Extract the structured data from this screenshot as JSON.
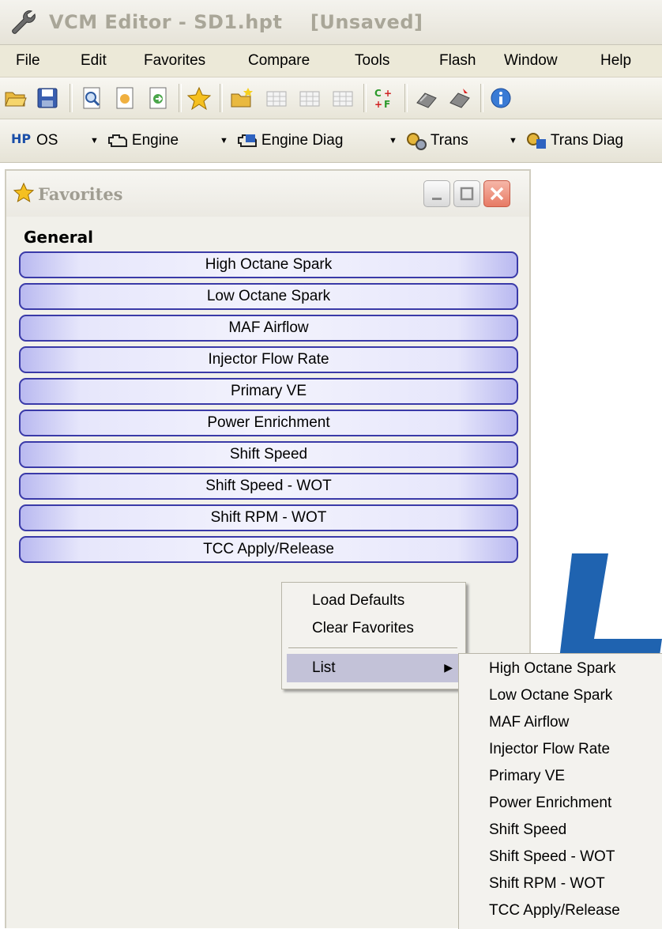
{
  "window": {
    "title": "VCM Editor - SD1.hpt    [Unsaved]"
  },
  "menu": [
    "File",
    "Edit",
    "Favorites",
    "Compare",
    "Tools",
    "Flash",
    "Window",
    "Help"
  ],
  "toolbar": {
    "icons": [
      "open-folder-icon",
      "save-icon",
      "document-search-icon",
      "document-icon",
      "document-go-icon",
      "favorites-star-icon",
      "new-folder-icon",
      "table-icon",
      "table-edit-icon",
      "table-compare-icon",
      "compare-cf-icon",
      "read-vehicle-icon",
      "write-vehicle-icon",
      "info-icon"
    ]
  },
  "modules": [
    {
      "label": "OS",
      "icon": "hp-logo-icon"
    },
    {
      "label": "Engine",
      "icon": "engine-icon"
    },
    {
      "label": "Engine Diag",
      "icon": "engine-diag-icon"
    },
    {
      "label": "Trans",
      "icon": "transmission-gear-icon"
    },
    {
      "label": "Trans Diag",
      "icon": "trans-diag-icon"
    }
  ],
  "favorites": {
    "title": "Favorites",
    "group": "General",
    "items": [
      "High Octane Spark",
      "Low Octane Spark",
      "MAF Airflow",
      "Injector Flow Rate",
      "Primary VE",
      "Power Enrichment",
      "Shift Speed",
      "Shift Speed - WOT",
      "Shift RPM - WOT",
      "TCC Apply/Release"
    ]
  },
  "context_menu": {
    "load_defaults": "Load Defaults",
    "clear_favorites": "Clear Favorites",
    "list": "List",
    "submenu": [
      "High Octane Spark",
      "Low Octane Spark",
      "MAF Airflow",
      "Injector Flow Rate",
      "Primary VE",
      "Power Enrichment",
      "Shift Speed",
      "Shift Speed - WOT",
      "Shift RPM - WOT",
      "TCC Apply/Release"
    ]
  },
  "colors": {
    "button_border": "#3a3aa8",
    "button_fill": "#e6e6fb",
    "menu_highlight": "#c3c2d8",
    "logo_blue": "#1f63b0"
  }
}
